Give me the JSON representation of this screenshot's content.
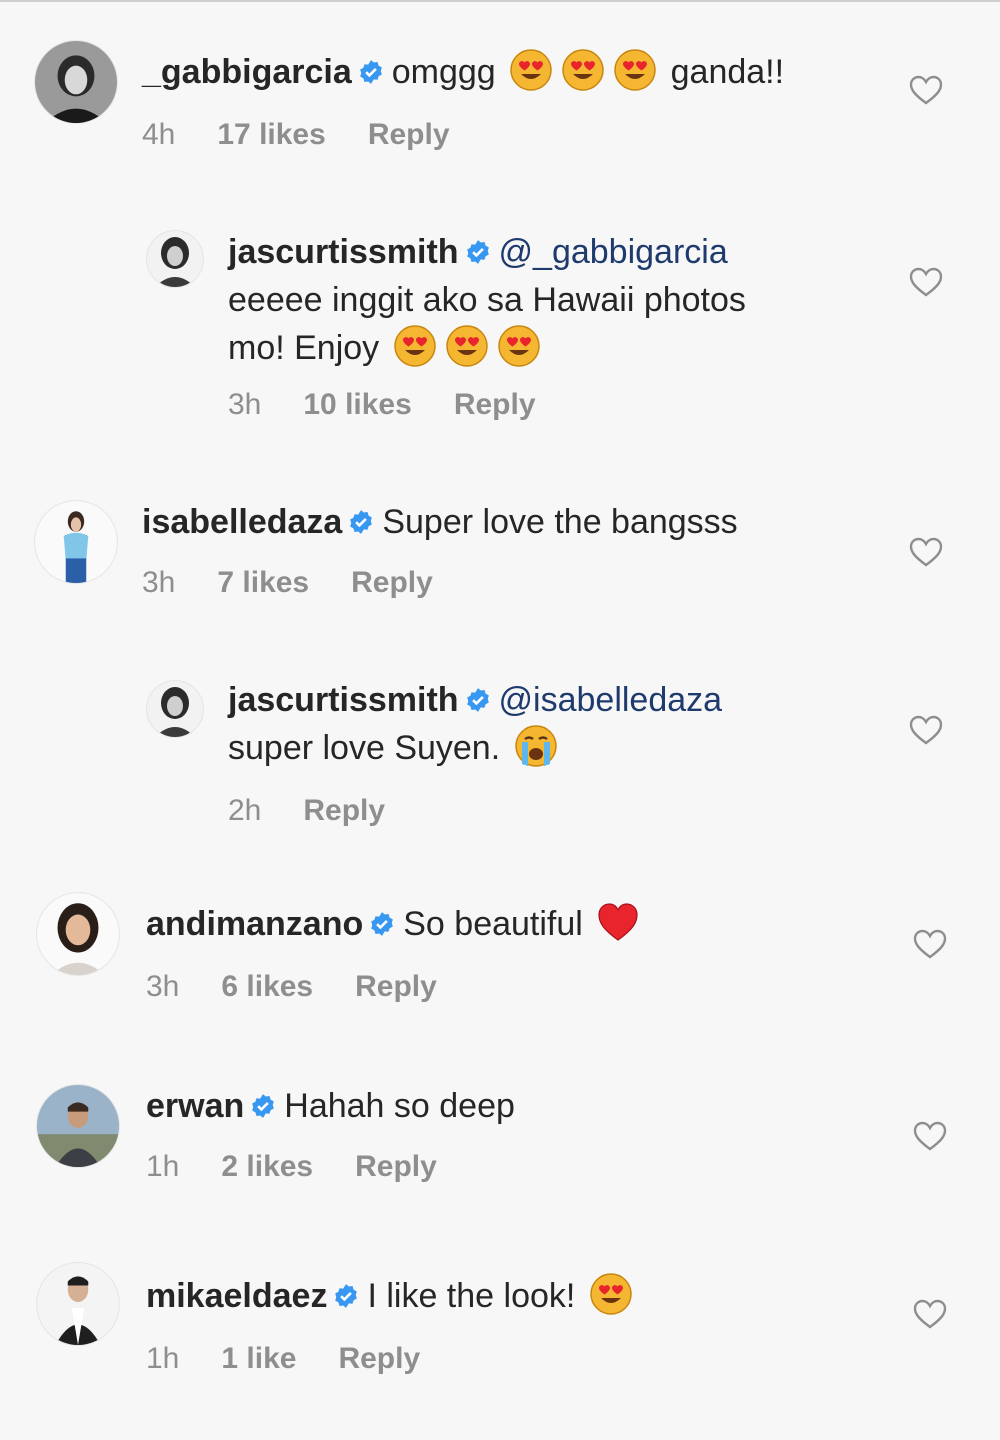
{
  "comments": [
    {
      "user": "_gabbigarcia",
      "verified": true,
      "mention": "",
      "text_before": "omggg",
      "emojis": [
        "heart-eyes",
        "heart-eyes",
        "heart-eyes"
      ],
      "text_after": "ganda!!",
      "time": "4h",
      "likes": "17 likes",
      "reply": "Reply"
    },
    {
      "user": "jascurtissmith",
      "verified": true,
      "mention": "@_gabbigarcia",
      "line2": "eeeee inggit ako sa Hawaii photos",
      "line3": "mo! Enjoy",
      "emojis": [
        "heart-eyes",
        "heart-eyes",
        "heart-eyes"
      ],
      "time": "3h",
      "likes": "10 likes",
      "reply": "Reply"
    },
    {
      "user": "isabelledaza",
      "verified": true,
      "text": "Super love the bangsss",
      "time": "3h",
      "likes": "7 likes",
      "reply": "Reply"
    },
    {
      "user": "jascurtissmith",
      "verified": true,
      "mention": "@isabelledaza",
      "line2": "super love Suyen.",
      "emojis": [
        "loudly-crying"
      ],
      "time": "2h",
      "reply": "Reply"
    },
    {
      "user": "andimanzano",
      "verified": true,
      "text": "So beautiful",
      "emojis": [
        "red-heart"
      ],
      "time": "3h",
      "likes": "6 likes",
      "reply": "Reply"
    },
    {
      "user": "erwan",
      "verified": true,
      "text": "Hahah so deep",
      "time": "1h",
      "likes": "2 likes",
      "reply": "Reply"
    },
    {
      "user": "mikaeldaez",
      "verified": true,
      "text": "I like the look!",
      "emojis": [
        "heart-eyes"
      ],
      "time": "1h",
      "likes": "1 like",
      "reply": "Reply"
    }
  ],
  "colors": {
    "background": "#f7f7f7",
    "text": "#262626",
    "muted": "#8e8e8e",
    "verified": "#3897f0",
    "mention": "#1f3b6e"
  }
}
